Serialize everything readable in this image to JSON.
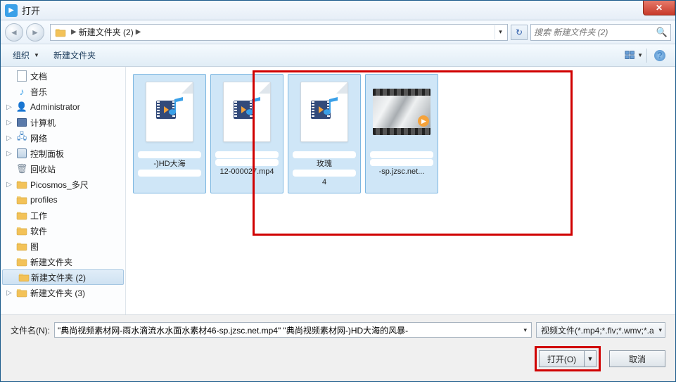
{
  "window": {
    "title": "打开"
  },
  "nav": {
    "path_segment": "新建文件夹 (2)",
    "search_placeholder": "搜索 新建文件夹 (2)"
  },
  "toolbar": {
    "organize": "组织",
    "new_folder": "新建文件夹"
  },
  "sidebar": {
    "items": [
      {
        "label": "文档",
        "icon": "doc"
      },
      {
        "label": "音乐",
        "icon": "music"
      },
      {
        "label": "Administrator",
        "icon": "user",
        "expandable": true
      },
      {
        "label": "计算机",
        "icon": "pc",
        "expandable": true
      },
      {
        "label": "网络",
        "icon": "net",
        "expandable": true
      },
      {
        "label": "控制面板",
        "icon": "ctrl",
        "expandable": true
      },
      {
        "label": "回收站",
        "icon": "bin"
      },
      {
        "label": "Picosmos_多尺",
        "icon": "folder",
        "expandable": true
      },
      {
        "label": "profiles",
        "icon": "folder"
      },
      {
        "label": "工作",
        "icon": "folder"
      },
      {
        "label": "软件",
        "icon": "folder"
      },
      {
        "label": "图",
        "icon": "folder"
      },
      {
        "label": "新建文件夹",
        "icon": "folder"
      },
      {
        "label": "新建文件夹 (2)",
        "icon": "folder",
        "selected": true
      },
      {
        "label": "新建文件夹 (3)",
        "icon": "folder",
        "expandable": true
      }
    ]
  },
  "files": [
    {
      "line1": "-)HD大海",
      "line2": "",
      "selected": true,
      "thumb": "media-doc"
    },
    {
      "line1": "",
      "line2": "12-000027.mp4",
      "selected": true,
      "thumb": "media-doc"
    },
    {
      "line1": "玫瑰",
      "line2": "4",
      "selected": true,
      "thumb": "media-doc"
    },
    {
      "line1": "",
      "line2": "-sp.jzsc.net...",
      "selected": true,
      "thumb": "video"
    }
  ],
  "footer": {
    "filename_label": "文件名(N):",
    "filename_value": "\"典尚视频素材网-雨水滴流水水面水素材46-sp.jzsc.net.mp4\" \"典尚视频素材网-)HD大海的风暴-",
    "filter_label": "视频文件(*.mp4;*.flv;*.wmv;*.a",
    "open": "打开(O)",
    "cancel": "取消"
  }
}
